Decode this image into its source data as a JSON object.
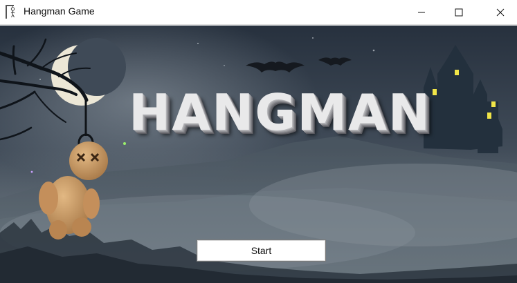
{
  "window": {
    "title": "Hangman Game",
    "app_icon": "hangman-figure-icon",
    "controls": {
      "minimize_icon": "minimize-icon",
      "maximize_icon": "maximize-icon",
      "close_icon": "close-icon"
    }
  },
  "game": {
    "title": "HANGMAN",
    "start_label": "Start",
    "background_theme": "night graveyard scene with crescent moon, bats, castle, and hanging voodoo doll"
  },
  "colors": {
    "sky_top": "#2a3442",
    "sky_mid": "#4a5663",
    "fog": "#6b7680",
    "moon": "#ece7d6",
    "castle": "#23303d",
    "window_light": "#f1e548",
    "doll": "#c99a66",
    "title_text": "#e9e9ea"
  }
}
